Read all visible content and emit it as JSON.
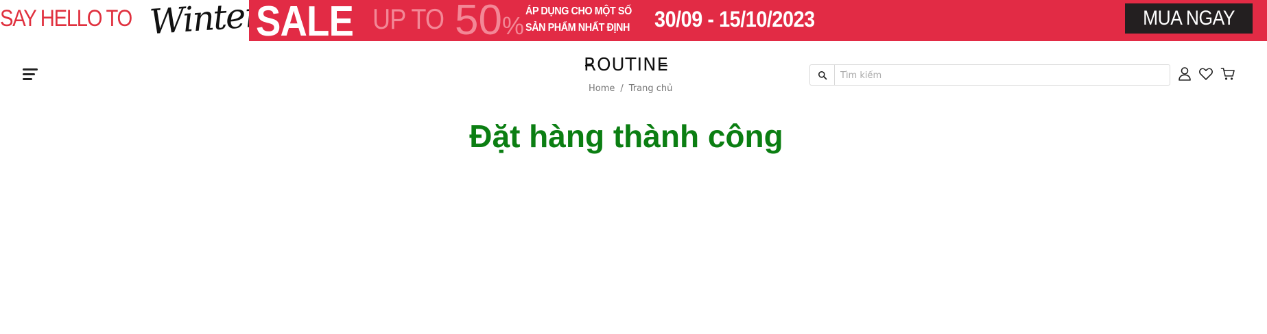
{
  "banner": {
    "say_hello": "SAY HELLO TO",
    "winter": "Winter",
    "sale": "SALE",
    "up_to": "UP TO",
    "percent_value": "50",
    "percent_sign": "%",
    "apply_line1": "ÁP DỤNG CHO MỘT SỐ",
    "apply_line2": "SẢN PHẨM NHẤT ĐỊNH",
    "dates": "30/09 - 15/10/2023",
    "buy_now": "MUA NGAY",
    "colors": {
      "red": "#e22b45",
      "dark": "#231f20"
    }
  },
  "header": {
    "logo": "ROUTINE",
    "breadcrumb": {
      "home": "Home",
      "separator": "/",
      "current": "Trang chủ"
    },
    "search": {
      "placeholder": "Tìm kiếm",
      "value": ""
    },
    "icons": [
      "menu-icon",
      "search-icon",
      "user-icon",
      "heart-icon",
      "cart-icon"
    ]
  },
  "main": {
    "title": "Đặt hàng thành công",
    "title_color": "#0b7e12"
  }
}
